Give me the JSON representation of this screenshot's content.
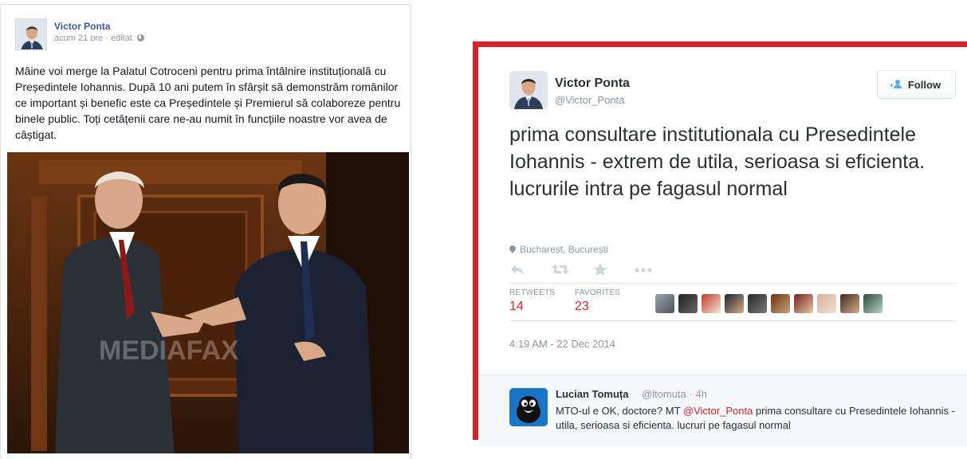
{
  "facebook": {
    "author": "Victor Ponta",
    "time": "acum 21 ore",
    "separator": "·",
    "edited": "editat",
    "text": "Mâine voi merge la Palatul Cotroceni pentru prima întâlnire instituțională cu Președintele Iohannis. După 10 ani putem în sfârșit să demonstrăm românilor ce important și benefic este ca Președintele și Premierul să colaboreze pentru binele public. Toți cetățenii care ne-au numit în funcțiile noastre vor avea de câștigat.",
    "photo_watermark": "MEDIAFAX"
  },
  "twitter": {
    "author": "Victor Ponta",
    "handle": "@Victor_Ponta",
    "follow_label": "Follow",
    "text": "prima consultare institutionala cu Presedintele Iohannis - extrem de utila, serioasa si eficienta. lucrurile intra pe fagasul normal",
    "location": "Bucharest, București",
    "actions": [
      "reply-icon",
      "retweet-icon",
      "favorite-icon",
      "more-icon"
    ],
    "retweets_label": "RETWEETS",
    "retweets": "14",
    "favorites_label": "FAVORITES",
    "favorites": "23",
    "timestamp": "4:19 AM - 22 Dec 2014",
    "accent_color": "#d8232a",
    "reply": {
      "author": "Lucian Tomuța",
      "handle": "@ltomuta",
      "separator": "·",
      "time": "4h",
      "text_before": "MTO-ul e OK, doctore? MT ",
      "mention": "@Victor_Ponta",
      "text_after": " prima consultare cu Presedintele Iohannis - utila, serioasa si eficienta. lucruri pe fagasul normal"
    }
  }
}
